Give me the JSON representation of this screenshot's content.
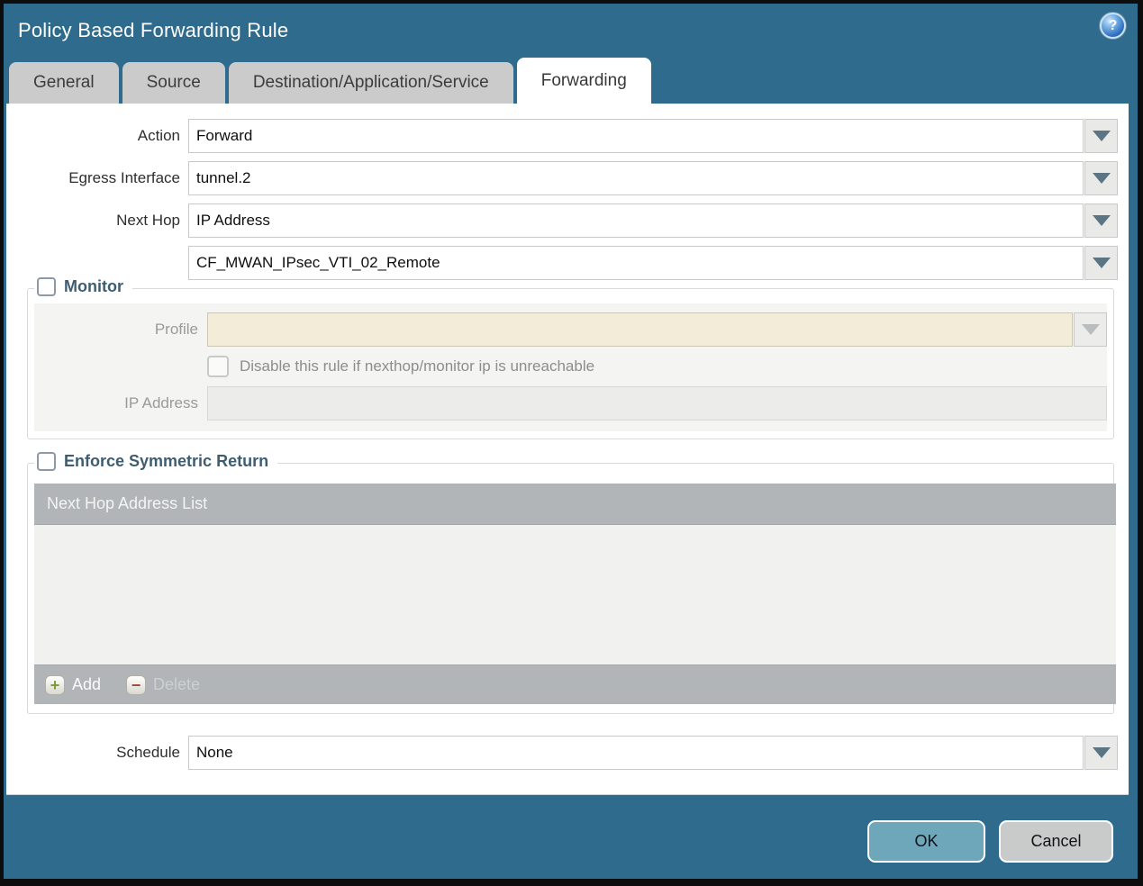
{
  "dialog": {
    "title": "Policy Based Forwarding Rule",
    "ok_label": "OK",
    "cancel_label": "Cancel"
  },
  "icons": {
    "help": "?",
    "add": "+",
    "delete": "−"
  },
  "tabs": [
    {
      "label": "General",
      "active": false
    },
    {
      "label": "Source",
      "active": false
    },
    {
      "label": "Destination/Application/Service",
      "active": false
    },
    {
      "label": "Forwarding",
      "active": true
    }
  ],
  "form": {
    "action": {
      "label": "Action",
      "value": "Forward"
    },
    "egress_interface": {
      "label": "Egress Interface",
      "value": "tunnel.2"
    },
    "next_hop": {
      "label": "Next Hop",
      "value": "IP Address"
    },
    "next_hop_address": {
      "value": "CF_MWAN_IPsec_VTI_02_Remote"
    },
    "schedule": {
      "label": "Schedule",
      "value": "None"
    }
  },
  "monitor": {
    "legend": "Monitor",
    "checked": false,
    "profile": {
      "label": "Profile",
      "value": ""
    },
    "disable_rule": {
      "label": "Disable this rule if nexthop/monitor ip is unreachable",
      "checked": false
    },
    "ip_address": {
      "label": "IP Address",
      "value": ""
    }
  },
  "symmetric_return": {
    "legend": "Enforce Symmetric Return",
    "checked": false,
    "table": {
      "header": "Next Hop Address List",
      "rows": []
    },
    "add_label": "Add",
    "delete_label": "Delete"
  },
  "colors": {
    "titlebar": "#2e6b8c",
    "active_tab": "#ffffff",
    "inactive_tab": "#cbcbcb",
    "ok_button": "#6fa7ba",
    "cancel_button": "#c9cbcb",
    "disabled_field": "#f2ecd8",
    "table_header": "#b1b5b7",
    "section_title": "#3e5d70"
  }
}
